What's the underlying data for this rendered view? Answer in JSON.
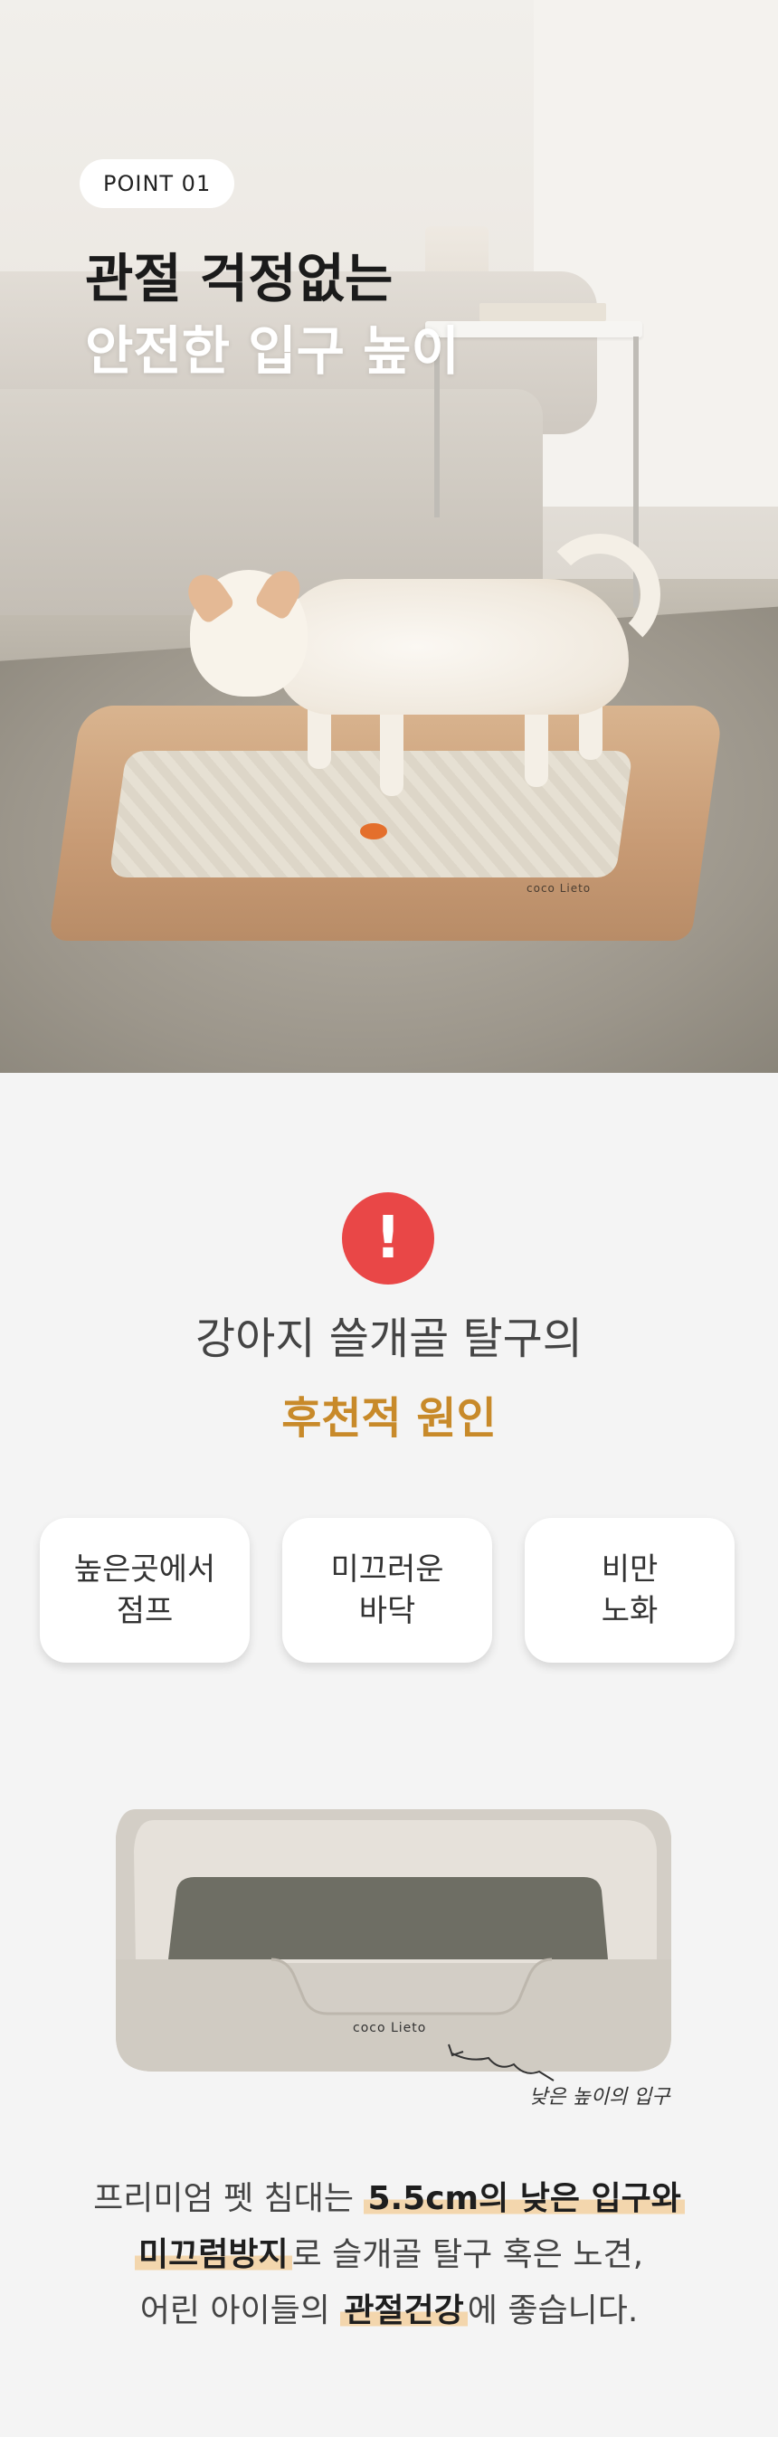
{
  "hero": {
    "badge": "POINT 01",
    "title_line1": "관절 걱정없는",
    "title_line2": "안전한 입구 높이",
    "bed_logo": "coco Lieto"
  },
  "causes": {
    "icon": "exclamation-icon",
    "icon_glyph": "!",
    "line1": "강아지 쓸개골 탈구의",
    "line2": "후천적 원인",
    "cards": [
      {
        "label": "높은곳에서\n점프"
      },
      {
        "label": "미끄러운\n바닥"
      },
      {
        "label": "비만\n노화"
      }
    ]
  },
  "illustration": {
    "bed_logo": "coco Lieto",
    "callout": "낮은 높이의 입구"
  },
  "description": {
    "l1_a": "프리미엄 펫 침대는 ",
    "l1_b": "5.5cm의 낮은 입구와",
    "l2_a": "미끄럼방지",
    "l2_b": "로 슬개골 탈구 혹은 노견,",
    "l3_a": "어린 아이들의 ",
    "l3_b": "관절건강",
    "l3_c": "에 좋습니다."
  },
  "colors": {
    "accent": "#c88a2a",
    "alert": "#e94747",
    "highlight": "#f3d6ad",
    "background": "#f4f4f4"
  }
}
